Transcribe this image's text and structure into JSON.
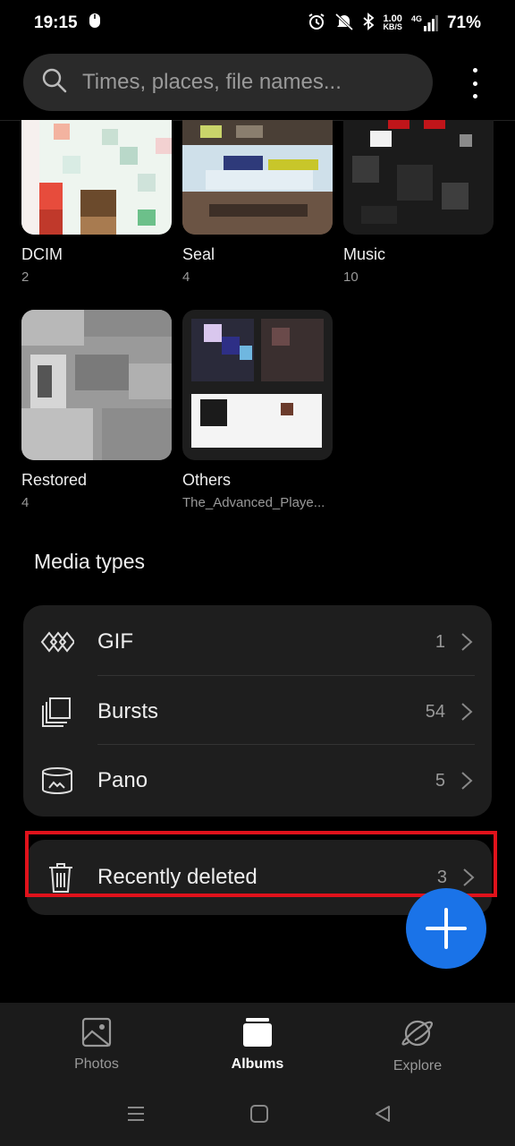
{
  "status_bar": {
    "time": "19:15",
    "network_speed_value": "1.00",
    "network_speed_unit": "KB/S",
    "network_type": "4G",
    "battery": "71%"
  },
  "search": {
    "placeholder": "Times, places, file names..."
  },
  "albums": [
    {
      "name": "DCIM",
      "count": "2"
    },
    {
      "name": "Seal",
      "count": "4"
    },
    {
      "name": "Music",
      "count": "10"
    },
    {
      "name": "Restored",
      "count": "4"
    },
    {
      "name": "Others",
      "count": "The_Advanced_Playe..."
    }
  ],
  "media_types": {
    "title": "Media types",
    "items": [
      {
        "label": "GIF",
        "count": "1",
        "icon": "gif-icon"
      },
      {
        "label": "Bursts",
        "count": "54",
        "icon": "bursts-icon"
      },
      {
        "label": "Pano",
        "count": "5",
        "icon": "pano-icon"
      }
    ]
  },
  "recently_deleted": {
    "label": "Recently deleted",
    "count": "3",
    "icon": "trash-icon"
  },
  "bottom_nav": {
    "items": [
      {
        "label": "Photos",
        "icon": "photos-icon"
      },
      {
        "label": "Albums",
        "icon": "albums-icon",
        "active": true
      },
      {
        "label": "Explore",
        "icon": "explore-icon"
      }
    ]
  },
  "colors": {
    "accent": "#1a73e8",
    "highlight": "#e0121b",
    "card": "#1e1e1e"
  }
}
